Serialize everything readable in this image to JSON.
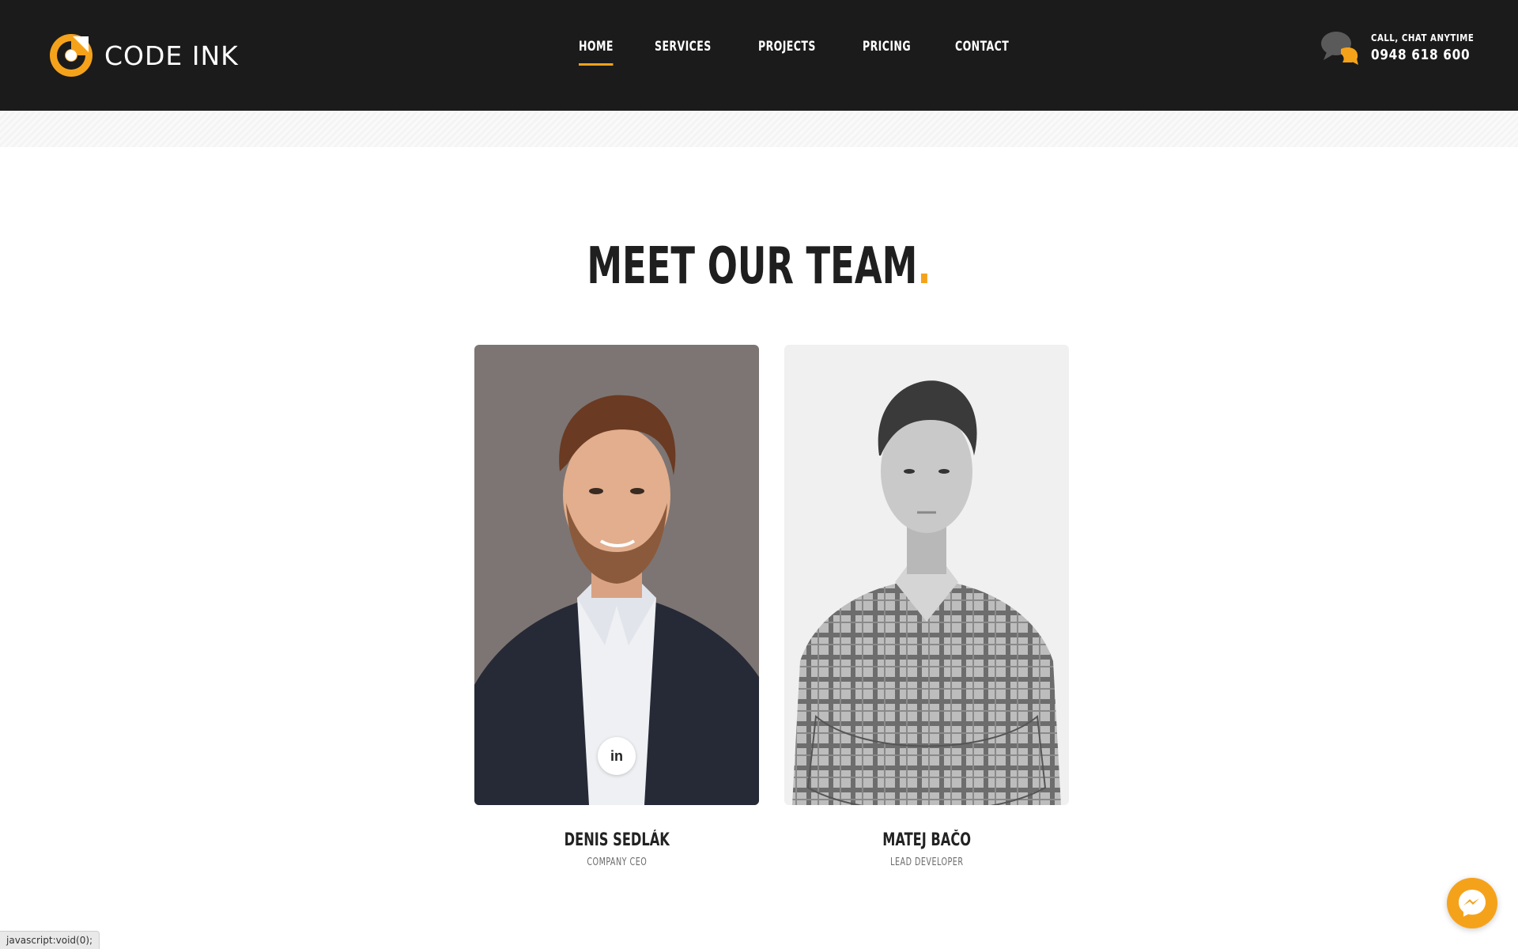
{
  "header": {
    "logo_text": "CODE INK",
    "nav": [
      {
        "label": "HOME",
        "active": true
      },
      {
        "label": "SERVICES",
        "active": false
      },
      {
        "label": "PROJECTS",
        "active": false
      },
      {
        "label": "PRICING",
        "active": false
      },
      {
        "label": "CONTACT",
        "active": false
      }
    ],
    "contact_label": "CALL, CHAT ANYTIME",
    "contact_phone": "0948 618 600",
    "contact_icon": "chat-bubbles-icon"
  },
  "team": {
    "title": "MEET OUR TEAM",
    "title_dot": ".",
    "members": [
      {
        "name": "DENIS SEDLÁK",
        "role": "COMPANY CEO",
        "social": "in",
        "social_icon": "linkedin-icon"
      },
      {
        "name": "MATEJ BAČO",
        "role": "LEAD DEVELOPER"
      }
    ]
  },
  "floating": {
    "messenger_icon": "messenger-icon"
  },
  "status_bar": {
    "text": "javascript:void(0);"
  },
  "colors": {
    "accent": "#f5a21b",
    "header_bg": "#1b1b1b",
    "title": "#1f1f1f"
  }
}
